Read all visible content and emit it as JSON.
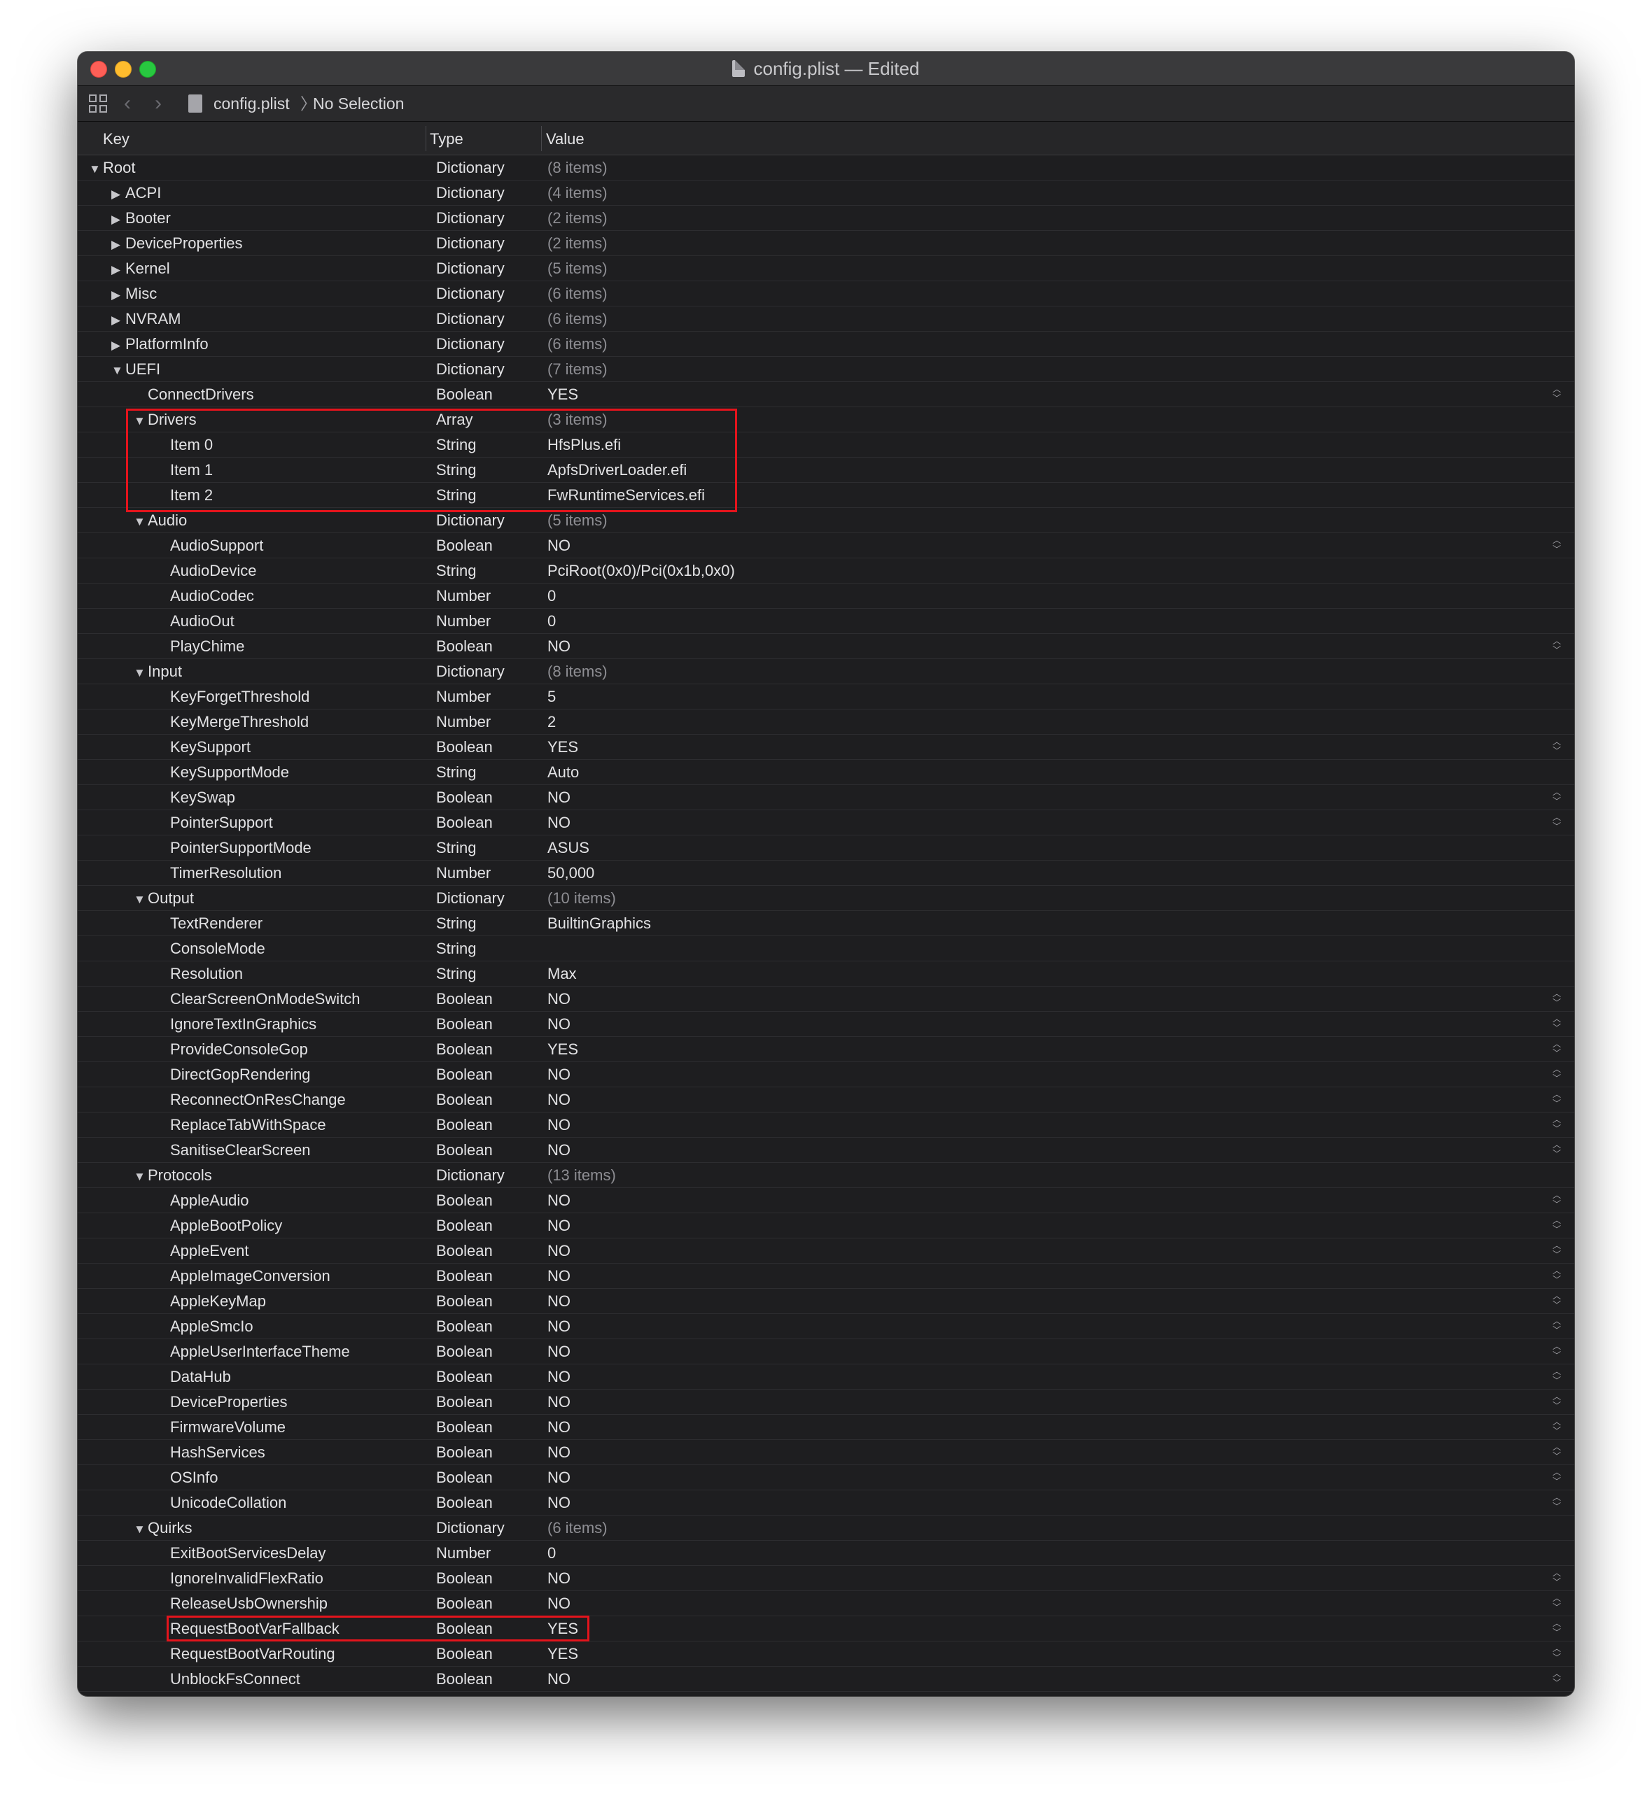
{
  "window": {
    "title": "config.plist — Edited"
  },
  "toolbar": {
    "file": "config.plist",
    "separator": "〉",
    "selection": "No Selection",
    "back_icon": "chevron-left-icon",
    "forward_icon": "chevron-right-icon"
  },
  "columns": {
    "key": "Key",
    "type": "Type",
    "value": "Value"
  },
  "highlight_color": "#e4141c",
  "rows": [
    {
      "level": 0,
      "disc": "open",
      "key": "Root",
      "type": "Dictionary",
      "value": "(8 items)",
      "muted": true
    },
    {
      "level": 1,
      "disc": "closed",
      "key": "ACPI",
      "type": "Dictionary",
      "value": "(4 items)",
      "muted": true
    },
    {
      "level": 1,
      "disc": "closed",
      "key": "Booter",
      "type": "Dictionary",
      "value": "(2 items)",
      "muted": true
    },
    {
      "level": 1,
      "disc": "closed",
      "key": "DeviceProperties",
      "type": "Dictionary",
      "value": "(2 items)",
      "muted": true
    },
    {
      "level": 1,
      "disc": "closed",
      "key": "Kernel",
      "type": "Dictionary",
      "value": "(5 items)",
      "muted": true
    },
    {
      "level": 1,
      "disc": "closed",
      "key": "Misc",
      "type": "Dictionary",
      "value": "(6 items)",
      "muted": true
    },
    {
      "level": 1,
      "disc": "closed",
      "key": "NVRAM",
      "type": "Dictionary",
      "value": "(6 items)",
      "muted": true
    },
    {
      "level": 1,
      "disc": "closed",
      "key": "PlatformInfo",
      "type": "Dictionary",
      "value": "(6 items)",
      "muted": true
    },
    {
      "level": 1,
      "disc": "open",
      "key": "UEFI",
      "type": "Dictionary",
      "value": "(7 items)",
      "muted": true
    },
    {
      "level": 2,
      "disc": "",
      "key": "ConnectDrivers",
      "type": "Boolean",
      "value": "YES",
      "stepper": true
    },
    {
      "level": 2,
      "disc": "open",
      "key": "Drivers",
      "type": "Array",
      "value": "(3 items)",
      "muted": true
    },
    {
      "level": 3,
      "disc": "",
      "key": "Item 0",
      "type": "String",
      "value": "HfsPlus.efi"
    },
    {
      "level": 3,
      "disc": "",
      "key": "Item 1",
      "type": "String",
      "value": "ApfsDriverLoader.efi"
    },
    {
      "level": 3,
      "disc": "",
      "key": "Item 2",
      "type": "String",
      "value": "FwRuntimeServices.efi"
    },
    {
      "level": 2,
      "disc": "open",
      "key": "Audio",
      "type": "Dictionary",
      "value": "(5 items)",
      "muted": true
    },
    {
      "level": 3,
      "disc": "",
      "key": "AudioSupport",
      "type": "Boolean",
      "value": "NO",
      "stepper": true
    },
    {
      "level": 3,
      "disc": "",
      "key": "AudioDevice",
      "type": "String",
      "value": "PciRoot(0x0)/Pci(0x1b,0x0)"
    },
    {
      "level": 3,
      "disc": "",
      "key": "AudioCodec",
      "type": "Number",
      "value": "0"
    },
    {
      "level": 3,
      "disc": "",
      "key": "AudioOut",
      "type": "Number",
      "value": "0"
    },
    {
      "level": 3,
      "disc": "",
      "key": "PlayChime",
      "type": "Boolean",
      "value": "NO",
      "stepper": true
    },
    {
      "level": 2,
      "disc": "open",
      "key": "Input",
      "type": "Dictionary",
      "value": "(8 items)",
      "muted": true
    },
    {
      "level": 3,
      "disc": "",
      "key": "KeyForgetThreshold",
      "type": "Number",
      "value": "5"
    },
    {
      "level": 3,
      "disc": "",
      "key": "KeyMergeThreshold",
      "type": "Number",
      "value": "2"
    },
    {
      "level": 3,
      "disc": "",
      "key": "KeySupport",
      "type": "Boolean",
      "value": "YES",
      "stepper": true
    },
    {
      "level": 3,
      "disc": "",
      "key": "KeySupportMode",
      "type": "String",
      "value": "Auto"
    },
    {
      "level": 3,
      "disc": "",
      "key": "KeySwap",
      "type": "Boolean",
      "value": "NO",
      "stepper": true
    },
    {
      "level": 3,
      "disc": "",
      "key": "PointerSupport",
      "type": "Boolean",
      "value": "NO",
      "stepper": true
    },
    {
      "level": 3,
      "disc": "",
      "key": "PointerSupportMode",
      "type": "String",
      "value": "ASUS"
    },
    {
      "level": 3,
      "disc": "",
      "key": "TimerResolution",
      "type": "Number",
      "value": "50,000"
    },
    {
      "level": 2,
      "disc": "open",
      "key": "Output",
      "type": "Dictionary",
      "value": "(10 items)",
      "muted": true
    },
    {
      "level": 3,
      "disc": "",
      "key": "TextRenderer",
      "type": "String",
      "value": "BuiltinGraphics"
    },
    {
      "level": 3,
      "disc": "",
      "key": "ConsoleMode",
      "type": "String",
      "value": ""
    },
    {
      "level": 3,
      "disc": "",
      "key": "Resolution",
      "type": "String",
      "value": "Max"
    },
    {
      "level": 3,
      "disc": "",
      "key": "ClearScreenOnModeSwitch",
      "type": "Boolean",
      "value": "NO",
      "stepper": true
    },
    {
      "level": 3,
      "disc": "",
      "key": "IgnoreTextInGraphics",
      "type": "Boolean",
      "value": "NO",
      "stepper": true
    },
    {
      "level": 3,
      "disc": "",
      "key": "ProvideConsoleGop",
      "type": "Boolean",
      "value": "YES",
      "stepper": true
    },
    {
      "level": 3,
      "disc": "",
      "key": "DirectGopRendering",
      "type": "Boolean",
      "value": "NO",
      "stepper": true
    },
    {
      "level": 3,
      "disc": "",
      "key": "ReconnectOnResChange",
      "type": "Boolean",
      "value": "NO",
      "stepper": true
    },
    {
      "level": 3,
      "disc": "",
      "key": "ReplaceTabWithSpace",
      "type": "Boolean",
      "value": "NO",
      "stepper": true
    },
    {
      "level": 3,
      "disc": "",
      "key": "SanitiseClearScreen",
      "type": "Boolean",
      "value": "NO",
      "stepper": true
    },
    {
      "level": 2,
      "disc": "open",
      "key": "Protocols",
      "type": "Dictionary",
      "value": "(13 items)",
      "muted": true
    },
    {
      "level": 3,
      "disc": "",
      "key": "AppleAudio",
      "type": "Boolean",
      "value": "NO",
      "stepper": true
    },
    {
      "level": 3,
      "disc": "",
      "key": "AppleBootPolicy",
      "type": "Boolean",
      "value": "NO",
      "stepper": true
    },
    {
      "level": 3,
      "disc": "",
      "key": "AppleEvent",
      "type": "Boolean",
      "value": "NO",
      "stepper": true
    },
    {
      "level": 3,
      "disc": "",
      "key": "AppleImageConversion",
      "type": "Boolean",
      "value": "NO",
      "stepper": true
    },
    {
      "level": 3,
      "disc": "",
      "key": "AppleKeyMap",
      "type": "Boolean",
      "value": "NO",
      "stepper": true
    },
    {
      "level": 3,
      "disc": "",
      "key": "AppleSmcIo",
      "type": "Boolean",
      "value": "NO",
      "stepper": true
    },
    {
      "level": 3,
      "disc": "",
      "key": "AppleUserInterfaceTheme",
      "type": "Boolean",
      "value": "NO",
      "stepper": true
    },
    {
      "level": 3,
      "disc": "",
      "key": "DataHub",
      "type": "Boolean",
      "value": "NO",
      "stepper": true
    },
    {
      "level": 3,
      "disc": "",
      "key": "DeviceProperties",
      "type": "Boolean",
      "value": "NO",
      "stepper": true
    },
    {
      "level": 3,
      "disc": "",
      "key": "FirmwareVolume",
      "type": "Boolean",
      "value": "NO",
      "stepper": true
    },
    {
      "level": 3,
      "disc": "",
      "key": "HashServices",
      "type": "Boolean",
      "value": "NO",
      "stepper": true
    },
    {
      "level": 3,
      "disc": "",
      "key": "OSInfo",
      "type": "Boolean",
      "value": "NO",
      "stepper": true
    },
    {
      "level": 3,
      "disc": "",
      "key": "UnicodeCollation",
      "type": "Boolean",
      "value": "NO",
      "stepper": true
    },
    {
      "level": 2,
      "disc": "open",
      "key": "Quirks",
      "type": "Dictionary",
      "value": "(6 items)",
      "muted": true
    },
    {
      "level": 3,
      "disc": "",
      "key": "ExitBootServicesDelay",
      "type": "Number",
      "value": "0"
    },
    {
      "level": 3,
      "disc": "",
      "key": "IgnoreInvalidFlexRatio",
      "type": "Boolean",
      "value": "NO",
      "stepper": true
    },
    {
      "level": 3,
      "disc": "",
      "key": "ReleaseUsbOwnership",
      "type": "Boolean",
      "value": "NO",
      "stepper": true
    },
    {
      "level": 3,
      "disc": "",
      "key": "RequestBootVarFallback",
      "type": "Boolean",
      "value": "YES",
      "stepper": true
    },
    {
      "level": 3,
      "disc": "",
      "key": "RequestBootVarRouting",
      "type": "Boolean",
      "value": "YES",
      "stepper": true
    },
    {
      "level": 3,
      "disc": "",
      "key": "UnblockFsConnect",
      "type": "Boolean",
      "value": "NO",
      "stepper": true
    }
  ]
}
